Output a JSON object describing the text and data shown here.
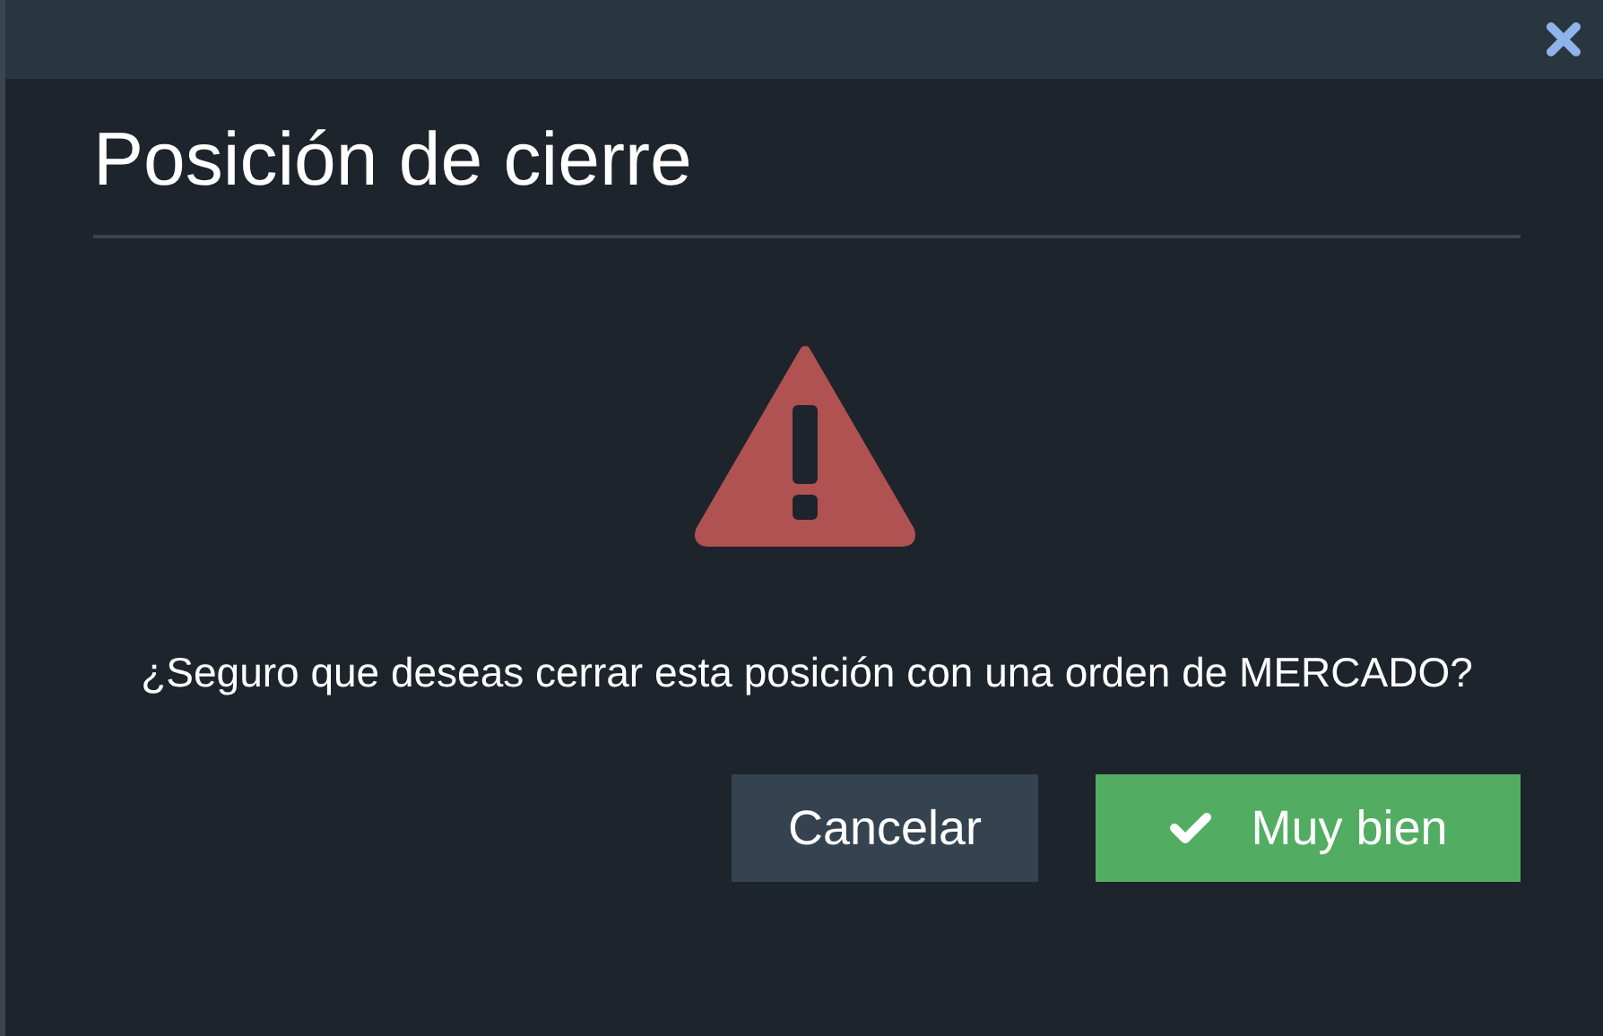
{
  "dialog": {
    "title": "Posición de cierre",
    "message": "¿Seguro que deseas cerrar esta posición con una orden de MERCADO?",
    "buttons": [
      {
        "kind": "cancel",
        "label": "Cancelar"
      },
      {
        "kind": "confirm",
        "label": "Muy bien"
      }
    ]
  }
}
